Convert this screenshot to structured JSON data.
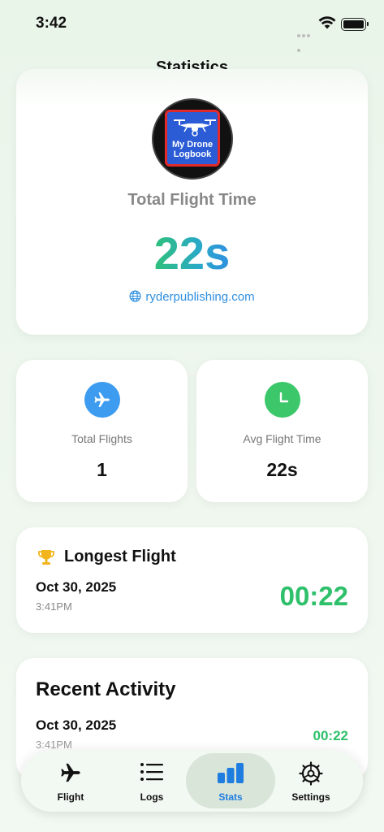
{
  "status_bar": {
    "time": "3:42"
  },
  "page": {
    "title": "Statistics"
  },
  "hero": {
    "logo_text_line1": "My Drone",
    "logo_text_line2": "Logbook",
    "label": "Total Flight Time",
    "value": "22s",
    "link": "ryderpublishing.com"
  },
  "stats": [
    {
      "label": "Total Flights",
      "value": "1",
      "icon": "airplane-icon",
      "color": "#3d9bf0"
    },
    {
      "label": "Avg Flight Time",
      "value": "22s",
      "icon": "clock-icon",
      "color": "#3cc86a"
    }
  ],
  "longest_flight": {
    "title": "Longest Flight",
    "date": "Oct 30, 2025",
    "time": "3:41PM",
    "duration": "00:22"
  },
  "recent_activity": {
    "title": "Recent Activity",
    "items": [
      {
        "date": "Oct 30, 2025",
        "time": "3:41PM",
        "duration": "00:22"
      }
    ]
  },
  "tabs": [
    {
      "label": "Flight",
      "icon": "airplane-icon"
    },
    {
      "label": "Logs",
      "icon": "list-icon"
    },
    {
      "label": "Stats",
      "icon": "bar-chart-icon",
      "active": true
    },
    {
      "label": "Settings",
      "icon": "gear-icon"
    }
  ],
  "colors": {
    "accent": "#1f7de0",
    "green": "#2fc06b",
    "blue": "#3d9bf0"
  }
}
